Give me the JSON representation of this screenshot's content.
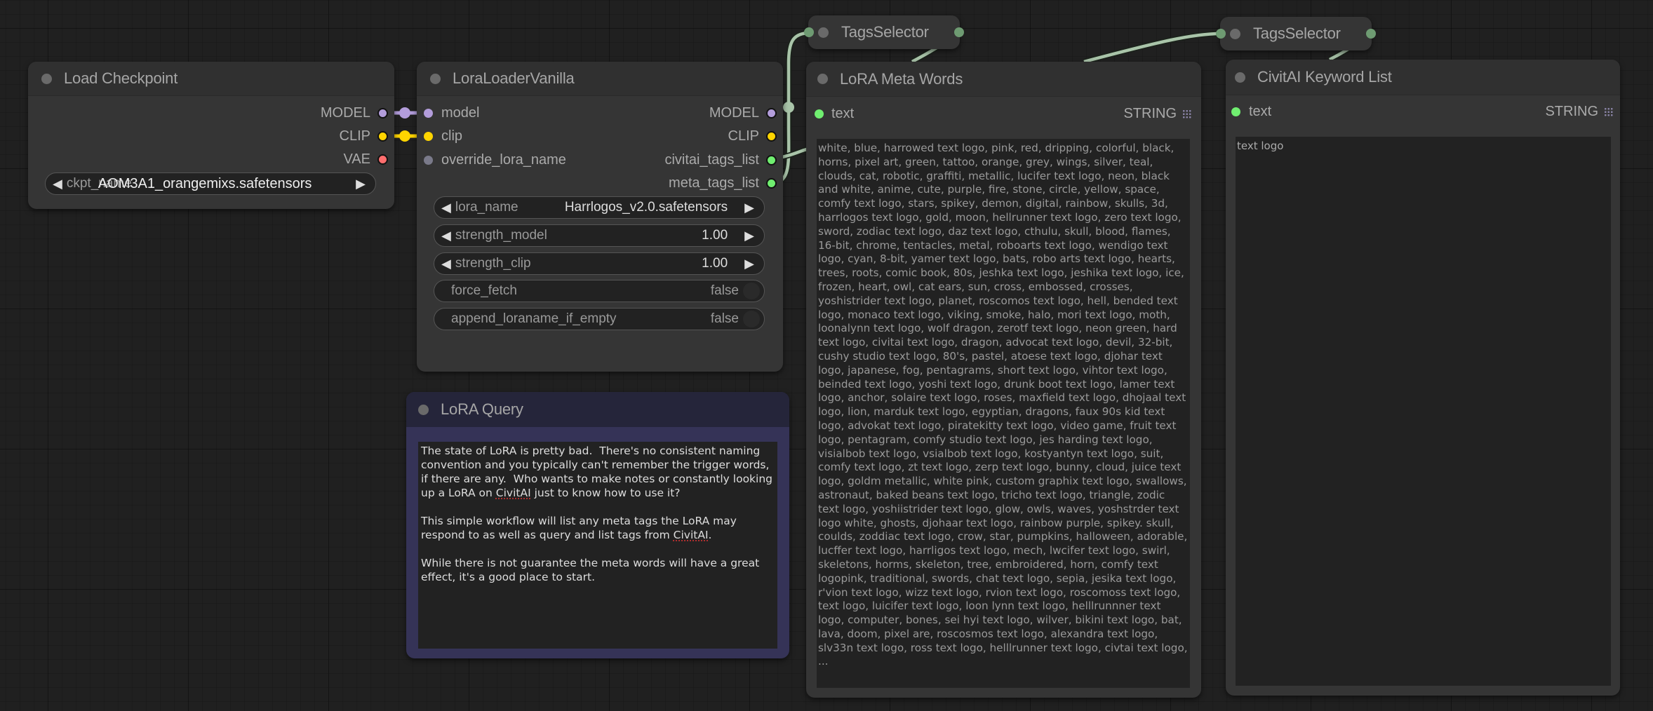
{
  "canvas": {
    "background": "#202020",
    "link_colors": {
      "model": "#b39ddb",
      "clip": "#ffd500",
      "string": "#9fb89f"
    }
  },
  "nodes": {
    "load_checkpoint": {
      "title": "Load Checkpoint",
      "outputs": [
        {
          "label": "MODEL",
          "color": "#b39ddb"
        },
        {
          "label": "CLIP",
          "color": "#ffd500"
        },
        {
          "label": "VAE",
          "color": "#ff6e6e"
        }
      ],
      "widgets": {
        "ckpt_name": {
          "label": "ckpt_name",
          "value": "AOM3A1_orangemixs.safetensors"
        }
      }
    },
    "lora_loader": {
      "title": "LoraLoaderVanilla",
      "inputs": [
        {
          "label": "model",
          "color": "#b39ddb"
        },
        {
          "label": "clip",
          "color": "#ffd500"
        },
        {
          "label": "override_lora_name",
          "color": "#7a7a8a"
        }
      ],
      "outputs": [
        {
          "label": "MODEL",
          "color": "#b39ddb"
        },
        {
          "label": "CLIP",
          "color": "#ffd500"
        },
        {
          "label": "civitai_tags_list",
          "color": "#70ef70"
        },
        {
          "label": "meta_tags_list",
          "color": "#70ef70"
        }
      ],
      "widgets": {
        "lora_name": {
          "label": "lora_name",
          "value": "Harrlogos_v2.0.safetensors"
        },
        "strength_model": {
          "label": "strength_model",
          "value": "1.00"
        },
        "strength_clip": {
          "label": "strength_clip",
          "value": "1.00"
        },
        "force_fetch": {
          "label": "force_fetch",
          "value": "false"
        },
        "append_loraname_if_empty": {
          "label": "append_loraname_if_empty",
          "value": "false"
        }
      }
    },
    "lora_query": {
      "title": "LoRA Query",
      "text_p1a": "The state of LoRA is pretty bad.  There's no consistent naming convention and you typically can't remember the trigger words, if there are any.  Who wants to make notes or constantly looking up a LoRA on ",
      "text_p1_link": "CivitAI",
      "text_p1b": " just to know how to use it?\n\nThis simple workflow will list any meta tags the LoRA may respond to as well as query and list tags from ",
      "text_p2_link": "CivitAI",
      "text_p2b": ".\n\nWhile there is not guarantee the meta words will have a great effect, it's a good place to start."
    },
    "tags_selector_1": {
      "title": "TagsSelector"
    },
    "tags_selector_2": {
      "title": "TagsSelector"
    },
    "lora_meta_words": {
      "title": "LoRA Meta Words",
      "input_label": "text",
      "output_type": "STRING",
      "text": "white, blue, harrowed text logo, pink, red, dripping, colorful, black, horns, pixel art, green, tattoo, orange, grey, wings, silver, teal, clouds, cat, robotic, graffiti, metallic, lucifer text logo, neon, black and white, anime, cute, purple, fire, stone, circle, yellow, space, comfy text logo, stars, spikey, demon, digital, rainbow, skulls, 3d, harrlogos text logo, gold, moon, hellrunner text logo, zero text logo, sword, zodiac text logo, daz text logo, cthulu, skull, blood, flames, 16-bit, chrome, tentacles, metal, roboarts text logo, wendigo text logo, cyan, 8-bit, yamer text logo, bats, robo arts text logo, hearts, trees, roots, comic book, 80s, jeshka text logo, jeshika text logo, ice, frozen, heart, owl, cat ears, sun, cross, embossed, crosses, yoshistrider text logo, planet, roscomos text logo, hell, bended text logo, monaco text logo, viking, smoke, halo, mori text logo, moth, loonalynn text logo, wolf dragon, zerotf text logo, neon green, hard text logo, civitai text logo, dragon, advocat text logo, devil, 32-bit, cushy studio text logo, 80's, pastel, atoese text logo, djohar text logo, japanese, fog, pentagrams, short text logo, vihtor text logo, beinded text logo, yoshi text logo, drunk boot text logo, lamer text logo, anchor, solaire text logo, roses, maxfield text logo, dhojaal text logo, lion, marduk text logo, egyptian, dragons, faux 90s kid text logo, advokat text logo, piratekitty text logo, video game, fruit text logo, pentagram, comfy studio text logo, jes harding text logo, visialbob text logo, vsialbob text logo, kostyantyn text logo, suit, comfy  text logo, zt text logo, zerp text logo, bunny, cloud, juice text logo, goldm metallic, white  pink, custom graphix text logo, swallows, astronaut, baked beans text logo, tricho text logo, triangle, zodic text logo, yoshiistrider text logo, glow, owls, waves, yoshstrder text logo white, ghosts, djohaar text logo, rainbow purple, spikey. skull, coulds, zoddiac text logo, crow, star, pumpkins, halloween, adorable, lucffer text logo, harrligos text logo, mech, lwcifer text logo, swirl, skeletons, horms, skeleton, tree, embroidered, horn, comfy text logopink, traditional, swords, chat text logo, sepia, jesika text logo, r'vion text logo, wizz text logo, rvion text logo, roscomoss text logo, text logo, luicifer text logo, loon lynn text logo, helllrunnner text logo, computer, bones, sei hyi text logo, wilver, bikini text logo, bat, lava, doom, pixel are, roscosmos text logo, alexandra text logo, slv33n text logo, ross text logo, helllrunner text logo, civtai text logo, ..."
    },
    "civitai_keyword_list": {
      "title": "CivitAI Keyword List",
      "input_label": "text",
      "output_type": "STRING",
      "text": "text logo"
    }
  }
}
